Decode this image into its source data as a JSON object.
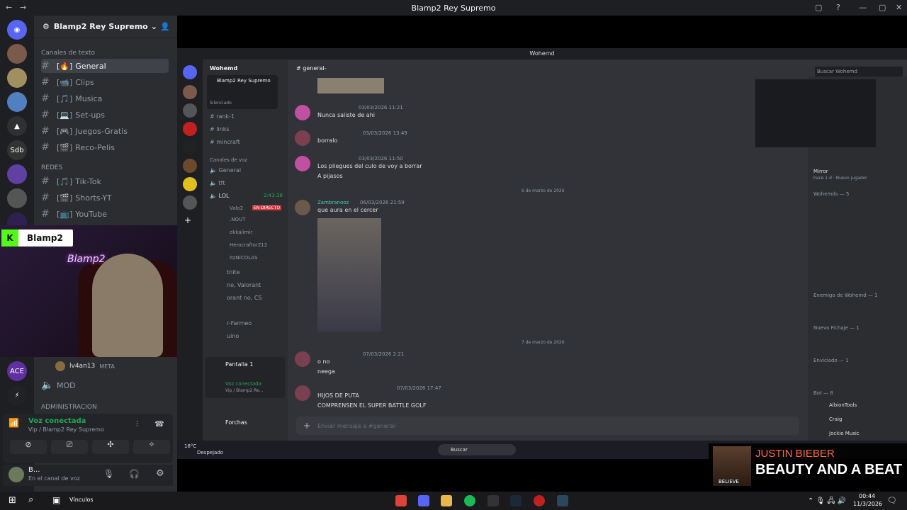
{
  "window": {
    "title": "Blamp2 Rey Supremo"
  },
  "server": {
    "name": "Blamp2 Rey Supremo",
    "badge": "2"
  },
  "categories": [
    {
      "label": "Canales de texto",
      "channels": [
        {
          "icon": "[🔥]",
          "name": "General"
        },
        {
          "icon": "[📹]",
          "name": "Clips"
        },
        {
          "icon": "[🎵]",
          "name": "Musica"
        },
        {
          "icon": "[💻]",
          "name": "Set-ups"
        },
        {
          "icon": "[🎮]",
          "name": "Juegos-Gratis"
        },
        {
          "icon": "[🎬]",
          "name": "Reco-Pelis"
        }
      ]
    },
    {
      "label": "REDES",
      "channels": [
        {
          "icon": "[🎵]",
          "name": "Tik-Tok"
        },
        {
          "icon": "[🎬]",
          "name": "Shorts-YT"
        },
        {
          "icon": "[📺]",
          "name": "YouTube"
        }
      ]
    }
  ],
  "voice_users": [
    {
      "name": "lv4an13",
      "tag": "META"
    },
    {
      "name": "MOD"
    }
  ],
  "admin_label": "ADMINISTRACION",
  "voice_panel": {
    "status": "Voz conectada",
    "sub": "Vip / Blamp2 Rey Supremo"
  },
  "user_panel": {
    "name": "B...",
    "sub": "En el canal de voz"
  },
  "cam": {
    "label": "Blamp2",
    "neon": "Blamp2"
  },
  "inner": {
    "title": "Wohemd",
    "server": "Wohemd",
    "channel": "general-",
    "search": "Buscar Wohemd",
    "side_server": "Blamp2 Rey Supremo",
    "side_sub": "Silenciado",
    "channels": [
      "rank-1",
      "links",
      "mincraft"
    ],
    "voice_cat": "Canales de voz",
    "voice_channels": [
      "General",
      "tft",
      "LOL"
    ],
    "lol_time": "2:43:38",
    "live_badge": "EN DIRECTO",
    "voice_users": [
      "Valo2",
      ".NOUT",
      "ekkalimir",
      "Herocraftor212",
      "ItzNICOLAS"
    ],
    "extra": [
      "tnite",
      "no, Valorant",
      "orant no, CS",
      "r-Farmeo",
      "uino"
    ],
    "screen_share": "Pantalla 1",
    "voice_status": "Voz conectada",
    "voice_sub": "Vip / Blamp2 Re...",
    "user": "Forchas",
    "messages": [
      {
        "time": "03/03/2026 11:21",
        "text": "Nunca saliste de ahi"
      },
      {
        "time": "03/03/2026 13:49",
        "text": "borralo"
      },
      {
        "time": "03/03/2026 11:50",
        "text": "Los pliegues del culo de voy a borrar",
        "text2": "A pijasos"
      },
      {
        "name": "Zambranooz",
        "time": "06/03/2026 21:59",
        "text": "que aura en el cercer"
      },
      {
        "time": "07/03/2026 2:21",
        "text": "o no",
        "text2": "neega"
      },
      {
        "time": "07/03/2026 17:47",
        "text": "HIJOS DE PUTA",
        "text2": "COMPRENSEN EL SUPER BATTLE GOLF"
      }
    ],
    "date_sep1": "6 de marzo de 2026",
    "date_sep2": "7 de marzo de 2026",
    "input_placeholder": "Enviar mensaje a #general-",
    "members": {
      "now_playing": "Mirror",
      "now_sub": "hace 1 d · Nuevo jugador",
      "wohemds": "Wohemds — 5",
      "enemigo": "Enemigo de Wohemd — 1",
      "nuevo": "Nuevo Fichaje — 1",
      "enviciado": "Enviciado — 1",
      "bot": "Bot — 8",
      "bots": [
        "AlbionTools",
        "Craig",
        "Jockie Music"
      ]
    }
  },
  "weather": {
    "temp": "18°C",
    "desc": "Despejado"
  },
  "search_taskbar": "Buscar",
  "music": {
    "artist": "JUSTIN BIEBER",
    "song": "BEAUTY AND A BEAT",
    "cover_text": "BELIEVE"
  },
  "taskbar": {
    "links": "Vínculos",
    "time": "00:44",
    "date": "11/3/2026"
  }
}
